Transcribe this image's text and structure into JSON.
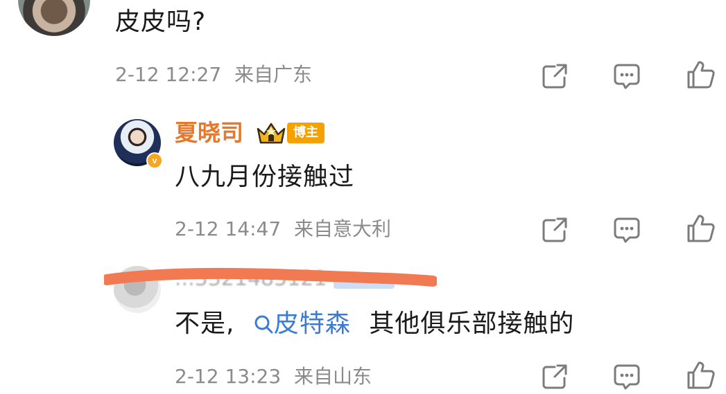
{
  "comments": [
    {
      "text": "皮皮吗?",
      "meta": {
        "date": "2-12 12:27",
        "location": "来自广东"
      }
    },
    {
      "username": "夏晓司",
      "badge": "博主",
      "text": "八九月份接触过",
      "meta": {
        "date": "2-12 14:47",
        "location": "来自意大利"
      }
    },
    {
      "username_obscured": "...3321485121",
      "text_before": "不是,",
      "mention": "皮特森",
      "text_after": "其他俱乐部接触的",
      "meta": {
        "date": "2-12 13:23",
        "location": "来自山东"
      }
    }
  ],
  "icons": [
    "share-icon",
    "comment-icon",
    "like-icon"
  ],
  "colors": {
    "username": "#e7772a",
    "mention": "#3a7bd5",
    "meta": "#8a8a8a",
    "badge": "#f5a100",
    "redaction": "#f27a52"
  }
}
